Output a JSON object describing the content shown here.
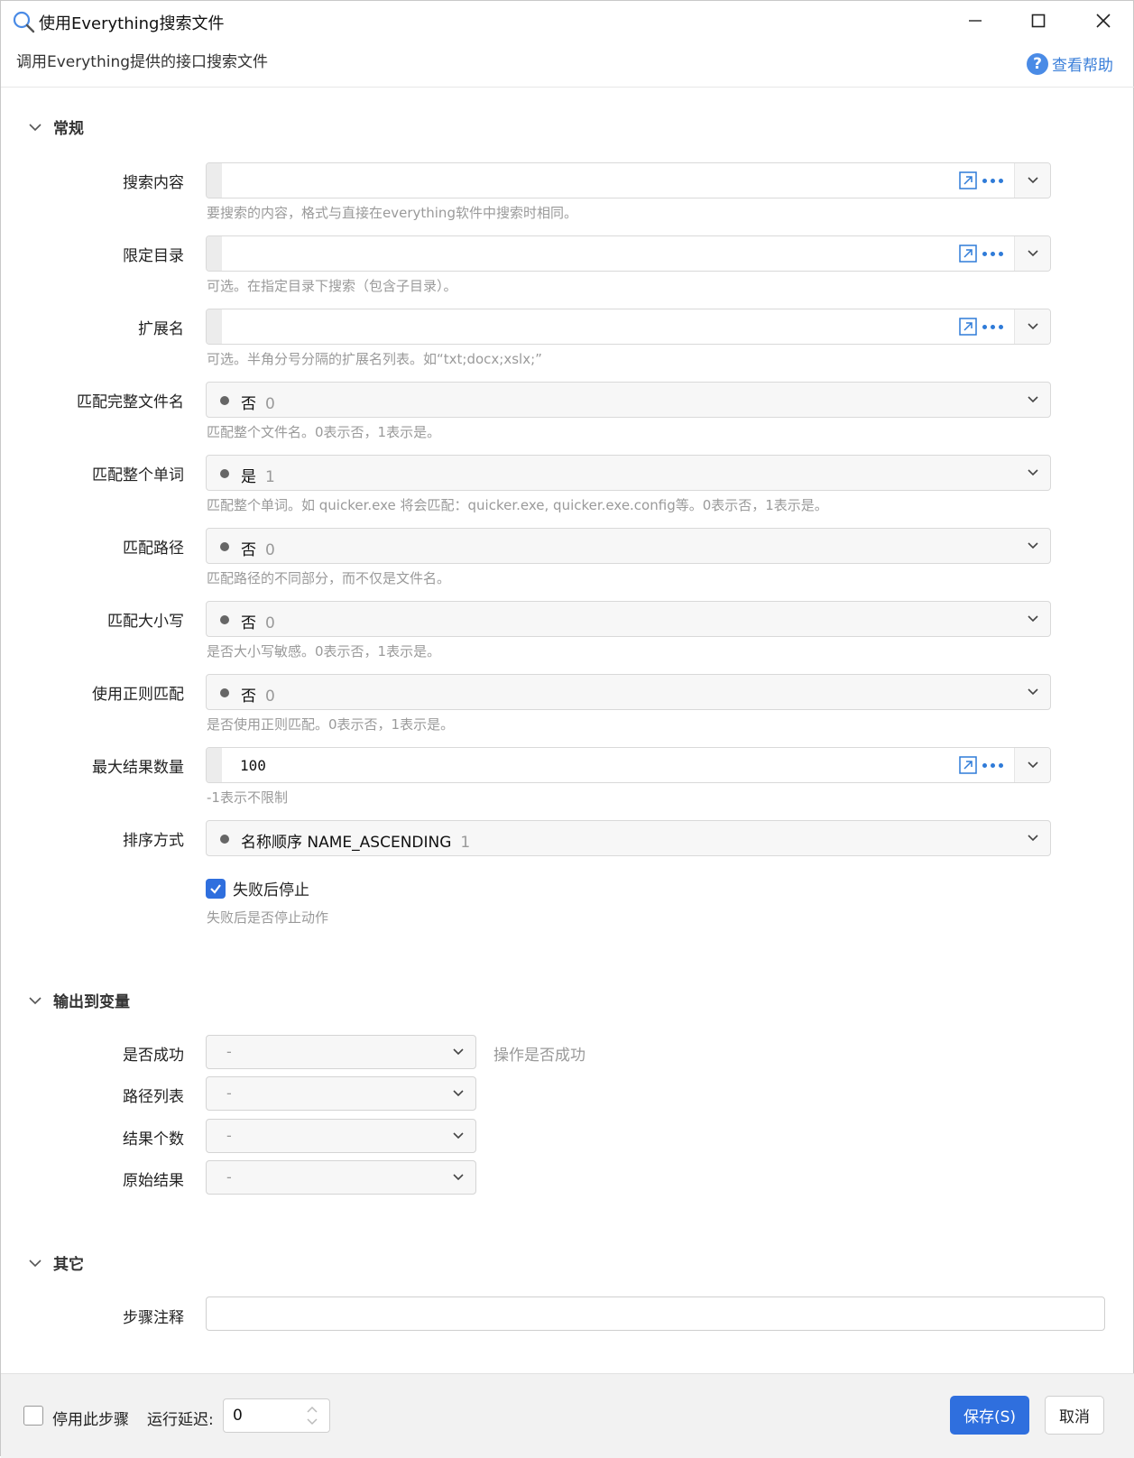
{
  "window": {
    "title": "使用Everything搜索文件",
    "subtitle": "调用Everything提供的接口搜索文件",
    "help_label": "查看帮助"
  },
  "sections": {
    "general": "常规",
    "output": "输出到变量",
    "other": "其它"
  },
  "fields": {
    "search_content": {
      "label": "搜索内容",
      "value": "",
      "hint": "要搜索的内容，格式与直接在everything软件中搜索时相同。"
    },
    "limit_dir": {
      "label": "限定目录",
      "value": "",
      "hint": "可选。在指定目录下搜索（包含子目录）。"
    },
    "extension": {
      "label": "扩展名",
      "value": "",
      "hint": "可选。半角分号分隔的扩展名列表。如“txt;docx;xslx;”"
    },
    "match_full_name": {
      "label": "匹配完整文件名",
      "option": "否",
      "code": "0",
      "hint": "匹配整个文件名。0表示否，1表示是。"
    },
    "match_whole_word": {
      "label": "匹配整个单词",
      "option": "是",
      "code": "1",
      "hint": "匹配整个单词。如 quicker.exe 将会匹配：quicker.exe, quicker.exe.config等。0表示否，1表示是。"
    },
    "match_path": {
      "label": "匹配路径",
      "option": "否",
      "code": "0",
      "hint": "匹配路径的不同部分，而不仅是文件名。"
    },
    "match_case": {
      "label": "匹配大小写",
      "option": "否",
      "code": "0",
      "hint": "是否大小写敏感。0表示否，1表示是。"
    },
    "use_regex": {
      "label": "使用正则匹配",
      "option": "否",
      "code": "0",
      "hint": "是否使用正则匹配。0表示否，1表示是。"
    },
    "max_results": {
      "label": "最大结果数量",
      "value": "100",
      "hint": "-1表示不限制"
    },
    "sort_order": {
      "label": "排序方式",
      "option": "名称顺序 NAME_ASCENDING",
      "code": "1"
    },
    "stop_on_fail": {
      "label": "失败后停止",
      "checked": true,
      "hint": "失败后是否停止动作"
    }
  },
  "outputs": [
    {
      "label": "是否成功",
      "value": "-",
      "note": "操作是否成功"
    },
    {
      "label": "路径列表",
      "value": "-",
      "note": ""
    },
    {
      "label": "结果个数",
      "value": "-",
      "note": ""
    },
    {
      "label": "原始结果",
      "value": "-",
      "note": ""
    }
  ],
  "other": {
    "comment_label": "步骤注释",
    "comment_value": ""
  },
  "footer": {
    "disable_label": "停用此步骤",
    "disable_checked": false,
    "delay_label": "运行延迟:",
    "delay_value": "0",
    "save_label": "保存(S)",
    "cancel_label": "取消"
  },
  "colors": {
    "accent": "#2f6fde",
    "link": "#3b7fd9",
    "hint": "#9a9a9a"
  }
}
